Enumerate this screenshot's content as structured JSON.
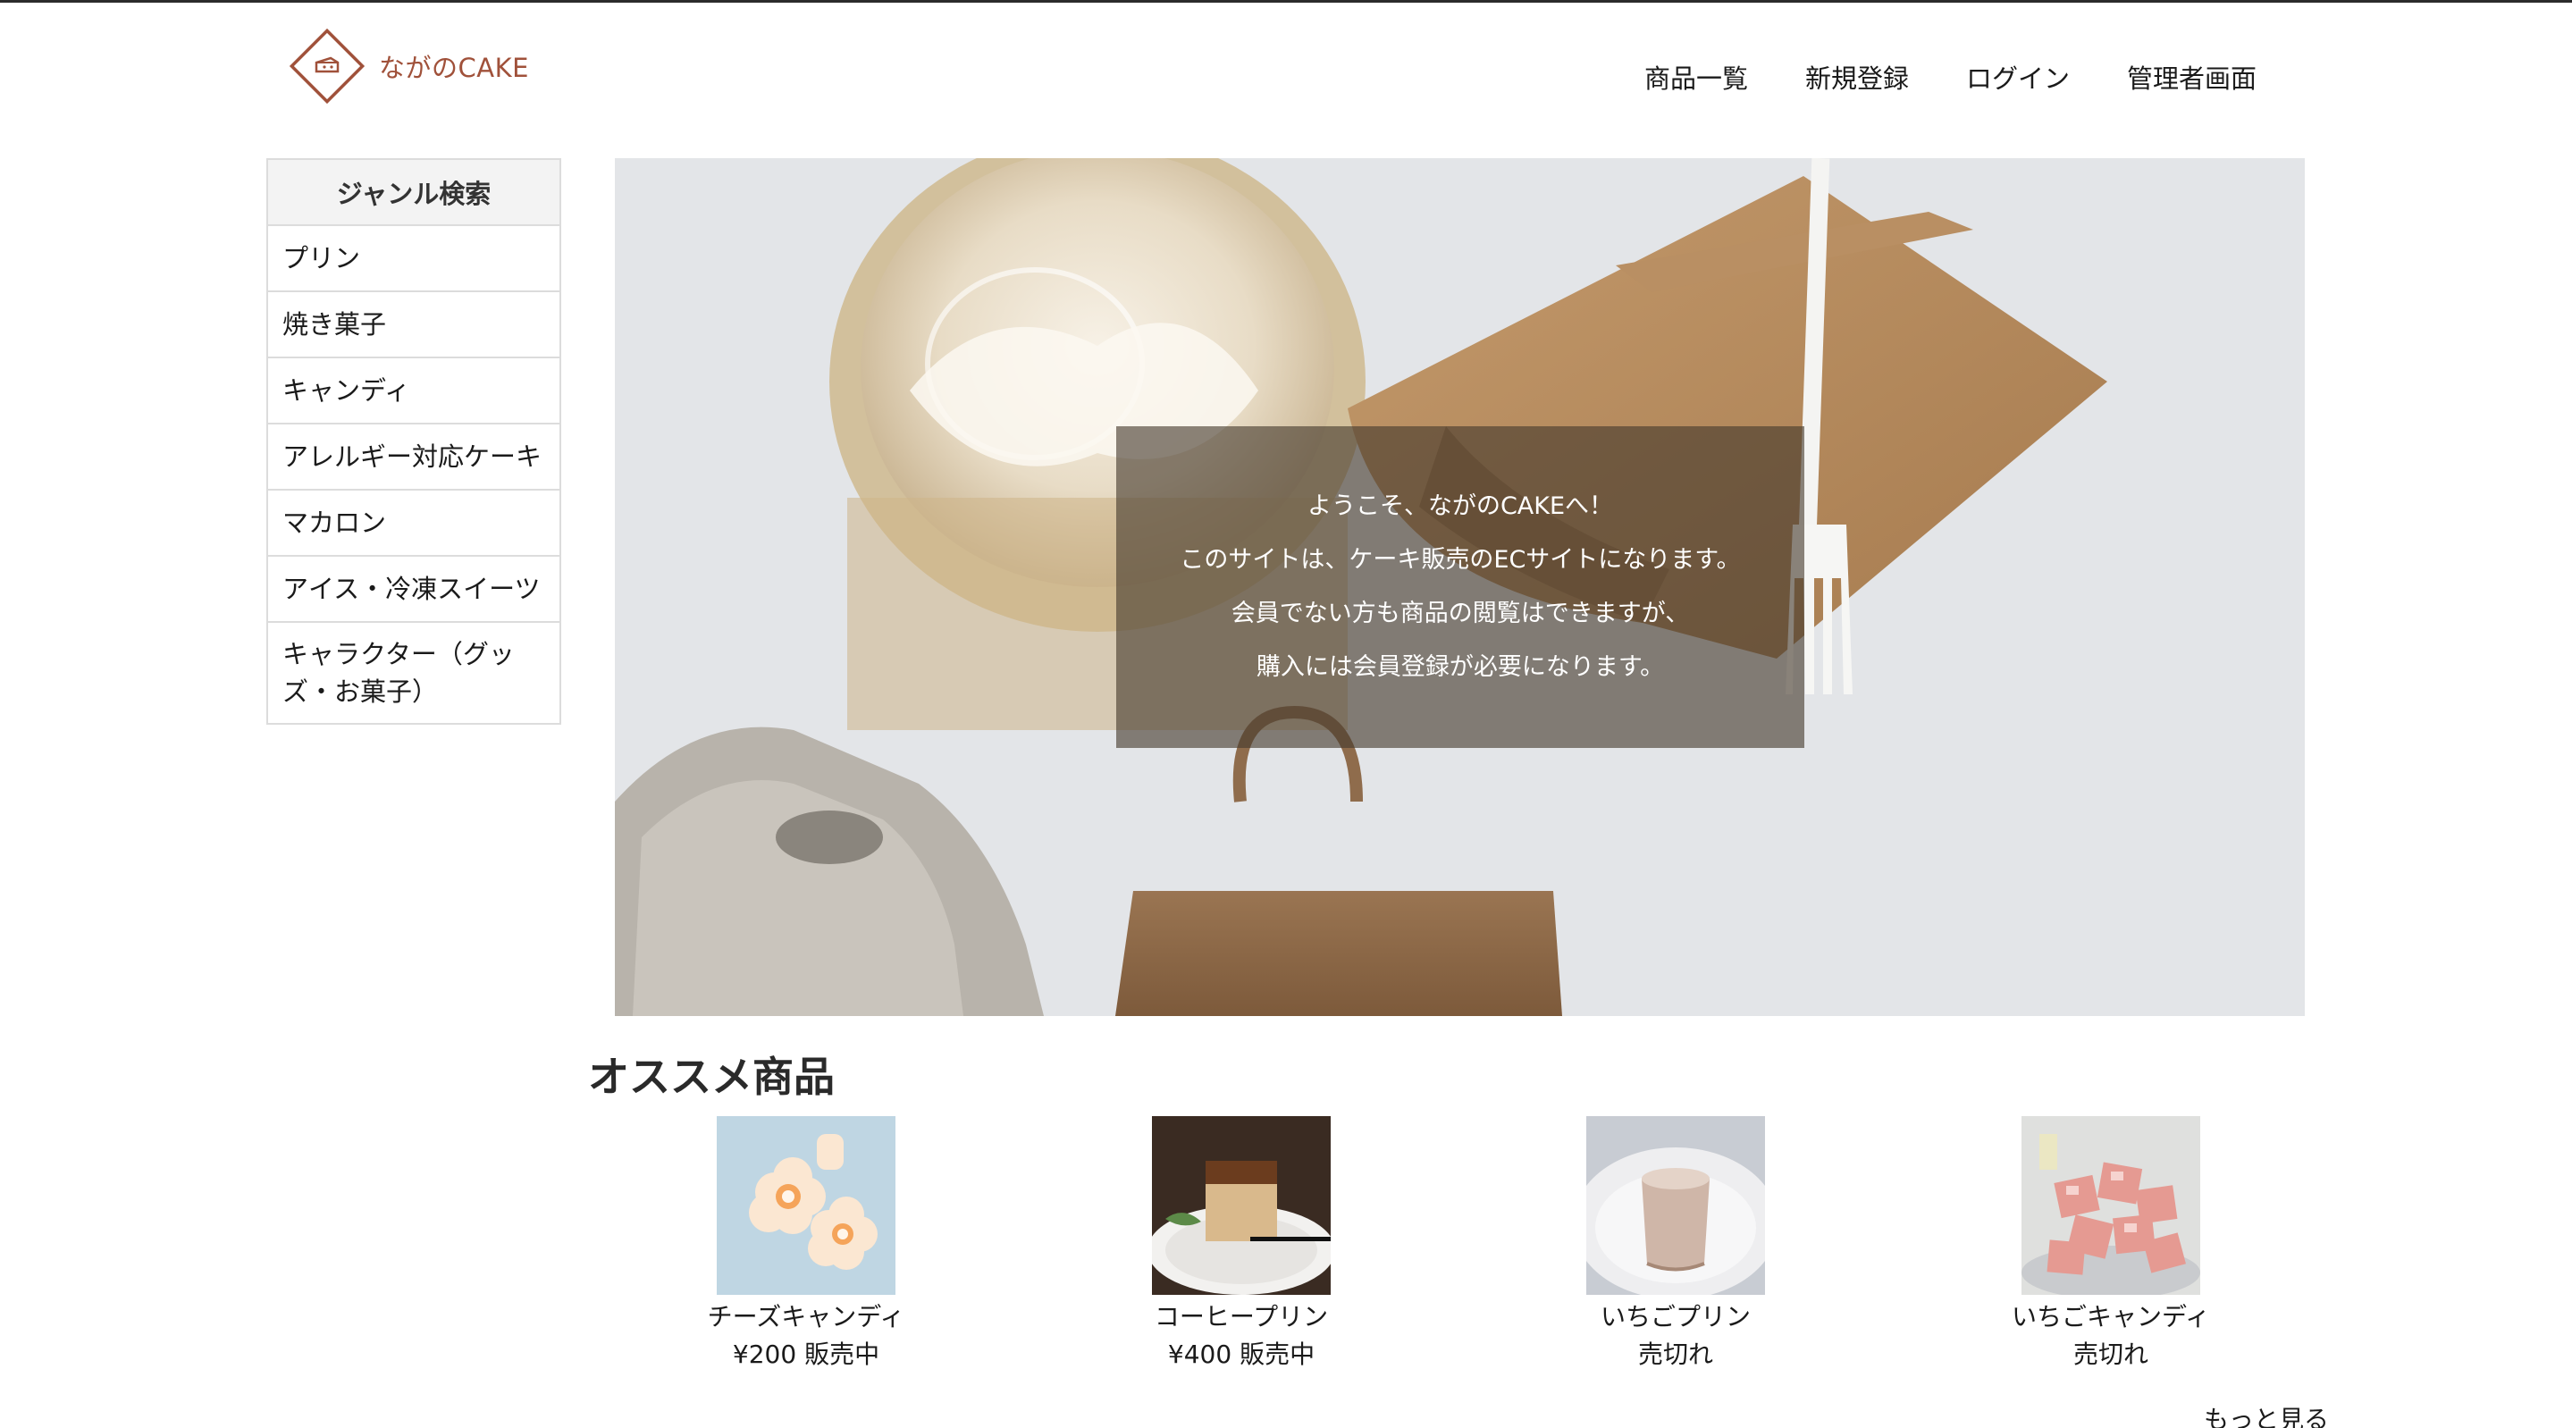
{
  "header": {
    "logo_text": "ながのCAKE",
    "logo_icon": "cake-icon",
    "brand_color": "#a0513a",
    "nav": [
      {
        "label": "商品一覧"
      },
      {
        "label": "新規登録"
      },
      {
        "label": "ログイン"
      },
      {
        "label": "管理者画面"
      }
    ]
  },
  "sidebar": {
    "title": "ジャンル検索",
    "items": [
      {
        "label": "プリン"
      },
      {
        "label": "焼き菓子"
      },
      {
        "label": "キャンディ"
      },
      {
        "label": "アレルギー対応ケーキ"
      },
      {
        "label": "マカロン"
      },
      {
        "label": "アイス・冷凍スイーツ"
      },
      {
        "label": "キャラクター（グッズ・お菓子）"
      }
    ]
  },
  "hero": {
    "lines": [
      "ようこそ、ながのCAKEへ！",
      "このサイトは、ケーキ販売のECサイトになります。",
      "会員でない方も商品の閲覧はできますが、",
      "購入には会員登録が必要になります。"
    ]
  },
  "recommended": {
    "title": "オススメ商品",
    "products": [
      {
        "name": "チーズキャンディ",
        "price": "¥200 販売中"
      },
      {
        "name": "コーヒープリン",
        "price": "¥400 販売中"
      },
      {
        "name": "いちごプリン",
        "price": "売切れ"
      },
      {
        "name": "いちごキャンディ",
        "price": "売切れ"
      }
    ],
    "more_label": "もっと見る"
  }
}
